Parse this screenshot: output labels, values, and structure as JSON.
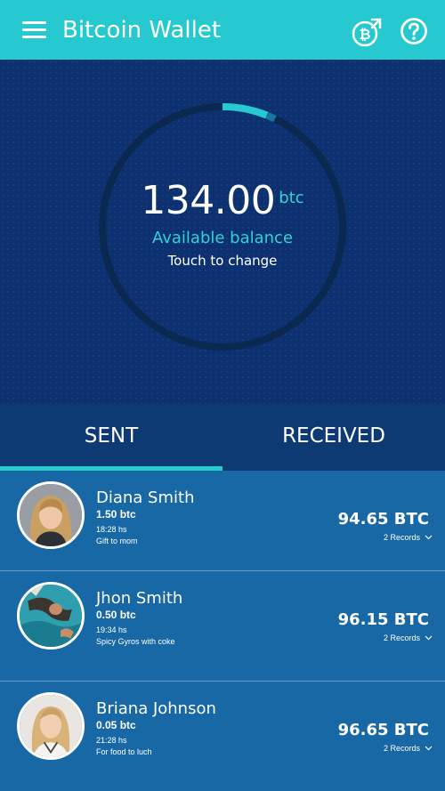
{
  "app": {
    "title": "Bitcoin Wallet",
    "accent_color": "#26c9cf",
    "hero_color": "#0d3170",
    "list_color": "#1868a6",
    "menu_icon": "hamburger-menu-icon",
    "send_icon": "bitcoin-send-icon",
    "help_icon": "help-circle-icon"
  },
  "balance": {
    "amount": "134.00",
    "unit": "btc",
    "label": "Available balance",
    "hint": "Touch to change",
    "ring_progress": 0.06
  },
  "tabs": {
    "sent": "SENT",
    "received": "RECEIVED",
    "active": "sent"
  },
  "transactions": [
    {
      "name": "Diana Smith",
      "amount": "1.50 btc",
      "time": "18:28 hs",
      "note": "Gift to mom",
      "total": "94.65 BTC",
      "records": "2 Records",
      "avatar": "woman-blonde-avatar"
    },
    {
      "name": "Jhon Smith",
      "amount": "0.50 btc",
      "time": "19:34 hs",
      "note": "Spicy Gyros with coke",
      "total": "96.15 BTC",
      "records": "2 Records",
      "avatar": "man-beach-avatar"
    },
    {
      "name": "Briana Johnson",
      "amount": "0.05 btc",
      "time": "21:28 hs",
      "note": "For food to luch",
      "total": "96.65 BTC",
      "records": "2 Records",
      "avatar": "woman-blonde-avatar-2"
    }
  ]
}
